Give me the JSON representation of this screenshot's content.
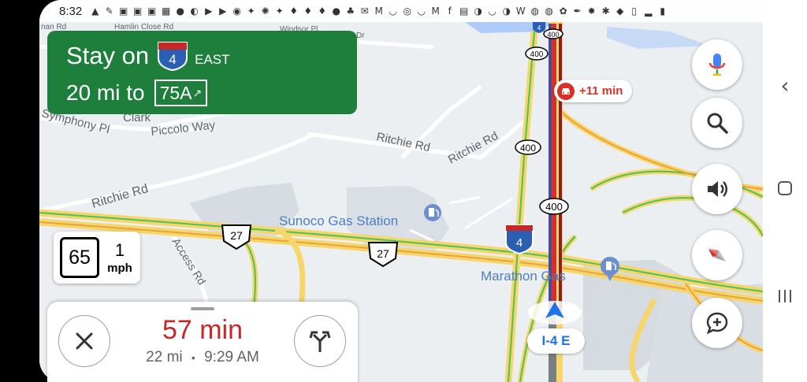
{
  "status_bar": {
    "time": "8:32",
    "icons": [
      "navigation-icon",
      "brush-icon",
      "word-icon",
      "word-icon",
      "word-icon",
      "calendar-icon",
      "pinterest-icon",
      "c-icon",
      "youtube-icon",
      "youtube-icon",
      "app-icon",
      "twitter-icon",
      "app-icon",
      "twitter-icon",
      "flame-icon",
      "flame-icon",
      "flame-icon",
      "reddit-icon",
      "app-icon",
      "mail-icon",
      "gmail-icon",
      "smile-icon",
      "instagram-icon",
      "smile-icon",
      "gmail-icon",
      "facebook-icon",
      "app-icon",
      "app-icon",
      "smile-icon",
      "app-icon",
      "wordpress-icon",
      "chrome-icon",
      "chrome-icon",
      "app-icon",
      "feather-icon",
      "app-icon",
      "bluetooth-icon",
      "location-icon",
      "vibrate-icon",
      "signal-icon",
      "battery-icon"
    ]
  },
  "banner": {
    "line1": "Stay on",
    "route_shield": "4",
    "direction": "EAST",
    "distance": "20 mi to",
    "exit": "75A"
  },
  "map_labels": {
    "street_top1": "Hamlin Close Rd",
    "street_top2": "Windsor Pl",
    "street_top3": "Dr",
    "street_top4": "nan Rd",
    "symphony": "Symphony Pl",
    "clark": "Clark",
    "piccolo": "Piccolo Way",
    "ritchie1": "Ritchie Rd",
    "ritchie2": "Ritchie Rd",
    "ritchie3": "Ritchie Rd",
    "access": "Access Rd",
    "sunoco": "Sunoco Gas Station",
    "marathon": "Marathon Gas",
    "us27_a": "27",
    "us27_b": "27",
    "i4": "4",
    "sr400_a": "400",
    "sr400_b": "400",
    "sr400_c": "400",
    "sr400_d": "400",
    "sr4_top": "4"
  },
  "traffic": {
    "delay": "+11 min"
  },
  "speed": {
    "limit": "65",
    "current": "1",
    "unit": "mph"
  },
  "trip": {
    "duration": "57 min",
    "distance": "22 mi",
    "separator": "•",
    "arrival": "9:29 AM"
  },
  "location": {
    "road": "I-4 E"
  },
  "colors": {
    "banner_green": "#1e7e3b",
    "traffic_red": "#d93025",
    "eta_red": "#c62828",
    "route_blue": "#1a73e8",
    "highway_yellow": "#f6d66a",
    "traffic_green": "#46c35a",
    "traffic_orange": "#f29c38"
  },
  "nav_icons": [
    "back-icon",
    "home-icon",
    "recents-icon"
  ],
  "buttons": [
    "microphone-icon",
    "search-icon",
    "sound-icon",
    "compass-icon",
    "add-report-icon",
    "close-icon",
    "alternate-routes-icon"
  ]
}
